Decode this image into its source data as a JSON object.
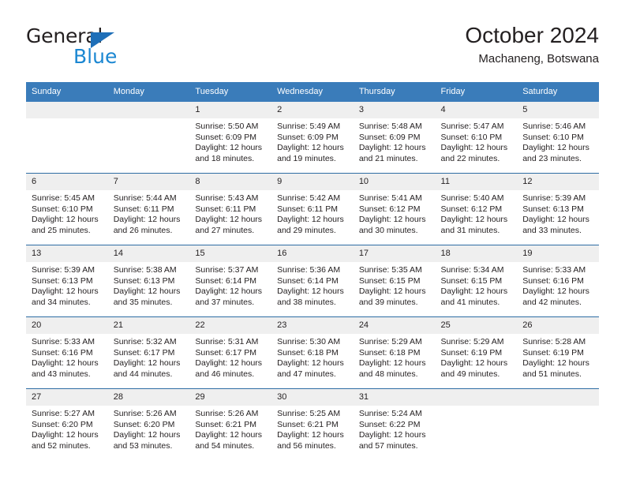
{
  "brand": {
    "name_part1": "General",
    "name_part2": "Blue",
    "accent_color": "#1b87d2",
    "flag_color": "#1e6fb8"
  },
  "header": {
    "title": "October 2024",
    "subtitle": "Machaneng, Botswana"
  },
  "theme": {
    "header_bg": "#3a7cba",
    "header_text": "#ffffff",
    "daynum_bg": "#efefef",
    "week_divider": "#2e6da4",
    "body_text": "#231f20"
  },
  "weekday_headers": [
    "Sunday",
    "Monday",
    "Tuesday",
    "Wednesday",
    "Thursday",
    "Friday",
    "Saturday"
  ],
  "labels": {
    "sunrise_prefix": "Sunrise:",
    "sunset_prefix": "Sunset:",
    "daylight_prefix": "Daylight:"
  },
  "weeks": [
    [
      {
        "day": "",
        "blank": true
      },
      {
        "day": "",
        "blank": true
      },
      {
        "day": "1",
        "sunrise": "Sunrise: 5:50 AM",
        "sunset": "Sunset: 6:09 PM",
        "daylight": "Daylight: 12 hours and 18 minutes."
      },
      {
        "day": "2",
        "sunrise": "Sunrise: 5:49 AM",
        "sunset": "Sunset: 6:09 PM",
        "daylight": "Daylight: 12 hours and 19 minutes."
      },
      {
        "day": "3",
        "sunrise": "Sunrise: 5:48 AM",
        "sunset": "Sunset: 6:09 PM",
        "daylight": "Daylight: 12 hours and 21 minutes."
      },
      {
        "day": "4",
        "sunrise": "Sunrise: 5:47 AM",
        "sunset": "Sunset: 6:10 PM",
        "daylight": "Daylight: 12 hours and 22 minutes."
      },
      {
        "day": "5",
        "sunrise": "Sunrise: 5:46 AM",
        "sunset": "Sunset: 6:10 PM",
        "daylight": "Daylight: 12 hours and 23 minutes."
      }
    ],
    [
      {
        "day": "6",
        "sunrise": "Sunrise: 5:45 AM",
        "sunset": "Sunset: 6:10 PM",
        "daylight": "Daylight: 12 hours and 25 minutes."
      },
      {
        "day": "7",
        "sunrise": "Sunrise: 5:44 AM",
        "sunset": "Sunset: 6:11 PM",
        "daylight": "Daylight: 12 hours and 26 minutes."
      },
      {
        "day": "8",
        "sunrise": "Sunrise: 5:43 AM",
        "sunset": "Sunset: 6:11 PM",
        "daylight": "Daylight: 12 hours and 27 minutes."
      },
      {
        "day": "9",
        "sunrise": "Sunrise: 5:42 AM",
        "sunset": "Sunset: 6:11 PM",
        "daylight": "Daylight: 12 hours and 29 minutes."
      },
      {
        "day": "10",
        "sunrise": "Sunrise: 5:41 AM",
        "sunset": "Sunset: 6:12 PM",
        "daylight": "Daylight: 12 hours and 30 minutes."
      },
      {
        "day": "11",
        "sunrise": "Sunrise: 5:40 AM",
        "sunset": "Sunset: 6:12 PM",
        "daylight": "Daylight: 12 hours and 31 minutes."
      },
      {
        "day": "12",
        "sunrise": "Sunrise: 5:39 AM",
        "sunset": "Sunset: 6:13 PM",
        "daylight": "Daylight: 12 hours and 33 minutes."
      }
    ],
    [
      {
        "day": "13",
        "sunrise": "Sunrise: 5:39 AM",
        "sunset": "Sunset: 6:13 PM",
        "daylight": "Daylight: 12 hours and 34 minutes."
      },
      {
        "day": "14",
        "sunrise": "Sunrise: 5:38 AM",
        "sunset": "Sunset: 6:13 PM",
        "daylight": "Daylight: 12 hours and 35 minutes."
      },
      {
        "day": "15",
        "sunrise": "Sunrise: 5:37 AM",
        "sunset": "Sunset: 6:14 PM",
        "daylight": "Daylight: 12 hours and 37 minutes."
      },
      {
        "day": "16",
        "sunrise": "Sunrise: 5:36 AM",
        "sunset": "Sunset: 6:14 PM",
        "daylight": "Daylight: 12 hours and 38 minutes."
      },
      {
        "day": "17",
        "sunrise": "Sunrise: 5:35 AM",
        "sunset": "Sunset: 6:15 PM",
        "daylight": "Daylight: 12 hours and 39 minutes."
      },
      {
        "day": "18",
        "sunrise": "Sunrise: 5:34 AM",
        "sunset": "Sunset: 6:15 PM",
        "daylight": "Daylight: 12 hours and 41 minutes."
      },
      {
        "day": "19",
        "sunrise": "Sunrise: 5:33 AM",
        "sunset": "Sunset: 6:16 PM",
        "daylight": "Daylight: 12 hours and 42 minutes."
      }
    ],
    [
      {
        "day": "20",
        "sunrise": "Sunrise: 5:33 AM",
        "sunset": "Sunset: 6:16 PM",
        "daylight": "Daylight: 12 hours and 43 minutes."
      },
      {
        "day": "21",
        "sunrise": "Sunrise: 5:32 AM",
        "sunset": "Sunset: 6:17 PM",
        "daylight": "Daylight: 12 hours and 44 minutes."
      },
      {
        "day": "22",
        "sunrise": "Sunrise: 5:31 AM",
        "sunset": "Sunset: 6:17 PM",
        "daylight": "Daylight: 12 hours and 46 minutes."
      },
      {
        "day": "23",
        "sunrise": "Sunrise: 5:30 AM",
        "sunset": "Sunset: 6:18 PM",
        "daylight": "Daylight: 12 hours and 47 minutes."
      },
      {
        "day": "24",
        "sunrise": "Sunrise: 5:29 AM",
        "sunset": "Sunset: 6:18 PM",
        "daylight": "Daylight: 12 hours and 48 minutes."
      },
      {
        "day": "25",
        "sunrise": "Sunrise: 5:29 AM",
        "sunset": "Sunset: 6:19 PM",
        "daylight": "Daylight: 12 hours and 49 minutes."
      },
      {
        "day": "26",
        "sunrise": "Sunrise: 5:28 AM",
        "sunset": "Sunset: 6:19 PM",
        "daylight": "Daylight: 12 hours and 51 minutes."
      }
    ],
    [
      {
        "day": "27",
        "sunrise": "Sunrise: 5:27 AM",
        "sunset": "Sunset: 6:20 PM",
        "daylight": "Daylight: 12 hours and 52 minutes."
      },
      {
        "day": "28",
        "sunrise": "Sunrise: 5:26 AM",
        "sunset": "Sunset: 6:20 PM",
        "daylight": "Daylight: 12 hours and 53 minutes."
      },
      {
        "day": "29",
        "sunrise": "Sunrise: 5:26 AM",
        "sunset": "Sunset: 6:21 PM",
        "daylight": "Daylight: 12 hours and 54 minutes."
      },
      {
        "day": "30",
        "sunrise": "Sunrise: 5:25 AM",
        "sunset": "Sunset: 6:21 PM",
        "daylight": "Daylight: 12 hours and 56 minutes."
      },
      {
        "day": "31",
        "sunrise": "Sunrise: 5:24 AM",
        "sunset": "Sunset: 6:22 PM",
        "daylight": "Daylight: 12 hours and 57 minutes."
      },
      {
        "day": "",
        "blank": true
      },
      {
        "day": "",
        "blank": true
      }
    ]
  ]
}
